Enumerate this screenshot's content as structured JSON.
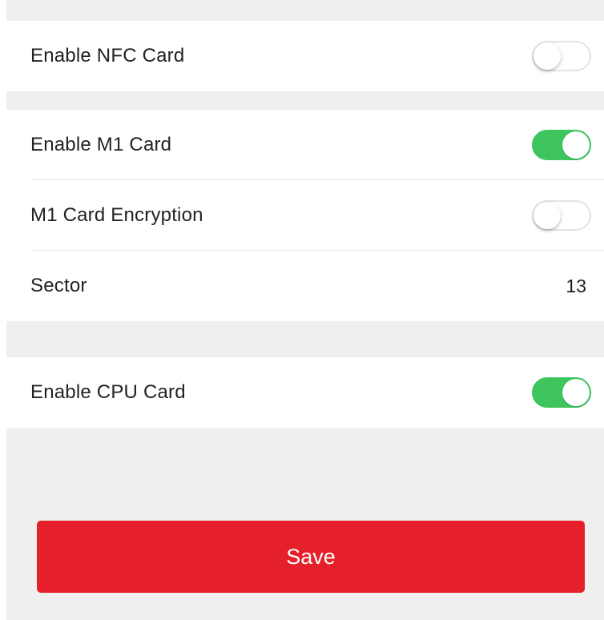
{
  "colors": {
    "page_background": "#efefef",
    "toggle_on": "#3ec55e",
    "save_button": "#e5202a"
  },
  "nfc_section": {
    "enable_nfc_card": {
      "label": "Enable NFC Card",
      "enabled": false
    }
  },
  "m1_section": {
    "enable_m1_card": {
      "label": "Enable M1 Card",
      "enabled": true
    },
    "m1_card_encryption": {
      "label": "M1 Card Encryption",
      "enabled": false
    },
    "sector": {
      "label": "Sector",
      "value": "13"
    }
  },
  "cpu_section": {
    "enable_cpu_card": {
      "label": "Enable CPU Card",
      "enabled": true
    }
  },
  "save_button": {
    "label": "Save"
  }
}
